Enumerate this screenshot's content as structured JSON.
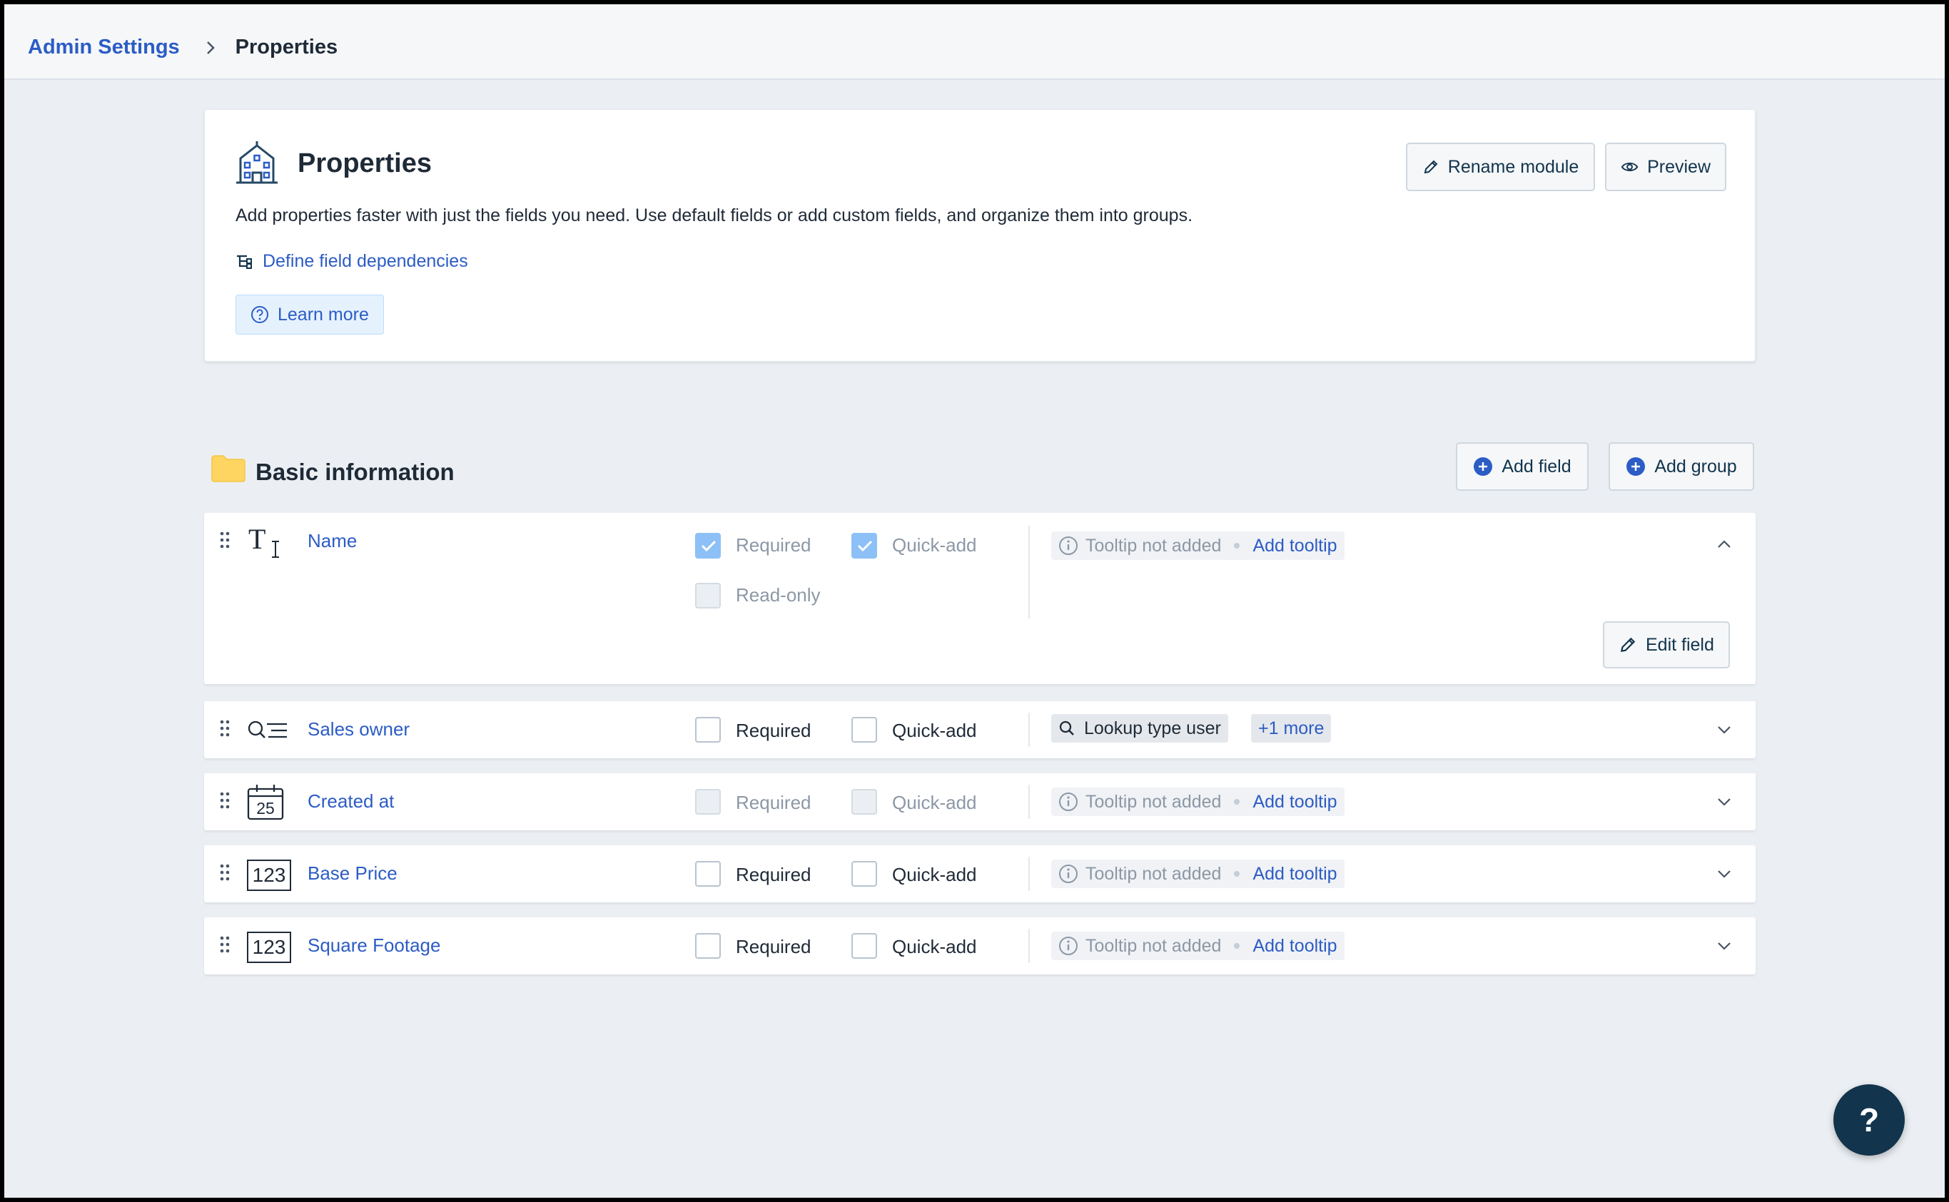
{
  "breadcrumb": {
    "parent": "Admin Settings",
    "current": "Properties"
  },
  "header": {
    "title": "Properties",
    "description": "Add properties faster with just the fields you need. Use default fields or add custom fields, and organize them into groups.",
    "dependencies_link": "Define field dependencies",
    "learn_more": "Learn more",
    "rename_button": "Rename module",
    "preview_button": "Preview"
  },
  "section": {
    "title": "Basic information",
    "add_field": "Add field",
    "add_group": "Add group"
  },
  "fields": [
    {
      "name": "Name",
      "icon": "text-field-icon",
      "required": true,
      "required_disabled": true,
      "quick_add": true,
      "quick_add_disabled": true,
      "read_only_label": "Read-only",
      "tooltip_status": "Tooltip not added",
      "tooltip_action": "Add tooltip",
      "expanded": true,
      "edit_label": "Edit field"
    },
    {
      "name": "Sales owner",
      "icon": "lookup-field-icon",
      "required": false,
      "quick_add": false,
      "lookup_label": "Lookup type user",
      "more_label": "+1 more",
      "expanded": false
    },
    {
      "name": "Created at",
      "icon": "date-field-icon",
      "icon_text": "25",
      "required": false,
      "required_disabled": true,
      "quick_add": false,
      "quick_add_disabled": true,
      "tooltip_status": "Tooltip not added",
      "tooltip_action": "Add tooltip",
      "expanded": false
    },
    {
      "name": "Base Price",
      "icon": "number-field-icon",
      "icon_text": "123",
      "required": false,
      "quick_add": false,
      "tooltip_status": "Tooltip not added",
      "tooltip_action": "Add tooltip",
      "expanded": false
    },
    {
      "name": "Square Footage",
      "icon": "number-field-icon",
      "icon_text": "123",
      "required": false,
      "quick_add": false,
      "tooltip_status": "Tooltip not added",
      "tooltip_action": "Add tooltip",
      "expanded": false
    }
  ],
  "labels": {
    "required": "Required",
    "quick_add": "Quick-add"
  },
  "help": {
    "label": "?"
  },
  "colors": {
    "accent": "#2c5cc5",
    "background": "#ebeff3",
    "help_button": "#12344d",
    "folder": "#ffd561"
  }
}
